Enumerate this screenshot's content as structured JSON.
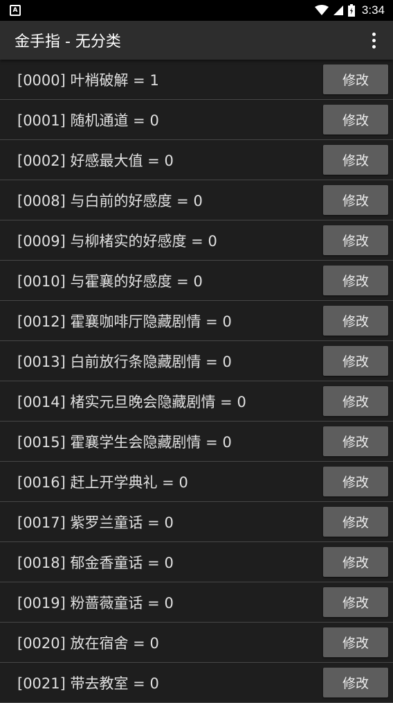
{
  "status_bar": {
    "notification_icon_letter": "A",
    "time": "3:34"
  },
  "app_bar": {
    "title": "金手指 - 无分类"
  },
  "cheats": [
    {
      "label": "[0000] 叶梢破解 = 1",
      "button": "修改"
    },
    {
      "label": "[0001] 随机通道 = 0",
      "button": "修改"
    },
    {
      "label": "[0002] 好感最大值 = 0",
      "button": "修改"
    },
    {
      "label": "[0008] 与白前的好感度 = 0",
      "button": "修改"
    },
    {
      "label": "[0009] 与柳楮实的好感度 = 0",
      "button": "修改"
    },
    {
      "label": "[0010] 与霍襄的好感度 = 0",
      "button": "修改"
    },
    {
      "label": "[0012] 霍襄咖啡厅隐藏剧情 = 0",
      "button": "修改"
    },
    {
      "label": "[0013] 白前放行条隐藏剧情 = 0",
      "button": "修改"
    },
    {
      "label": "[0014] 楮实元旦晚会隐藏剧情 = 0",
      "button": "修改"
    },
    {
      "label": "[0015] 霍襄学生会隐藏剧情 = 0",
      "button": "修改"
    },
    {
      "label": "[0016] 赶上开学典礼 = 0",
      "button": "修改"
    },
    {
      "label": "[0017] 紫罗兰童话 = 0",
      "button": "修改"
    },
    {
      "label": "[0018] 郁金香童话 = 0",
      "button": "修改"
    },
    {
      "label": "[0019] 粉蔷薇童话 = 0",
      "button": "修改"
    },
    {
      "label": "[0020] 放在宿舍 = 0",
      "button": "修改"
    },
    {
      "label": "[0021] 带去教室 = 0",
      "button": "修改"
    }
  ],
  "icons": {
    "wifi": "wifi-icon",
    "signal": "signal-icon",
    "battery": "battery-icon",
    "overflow": "more-vert-icon"
  }
}
